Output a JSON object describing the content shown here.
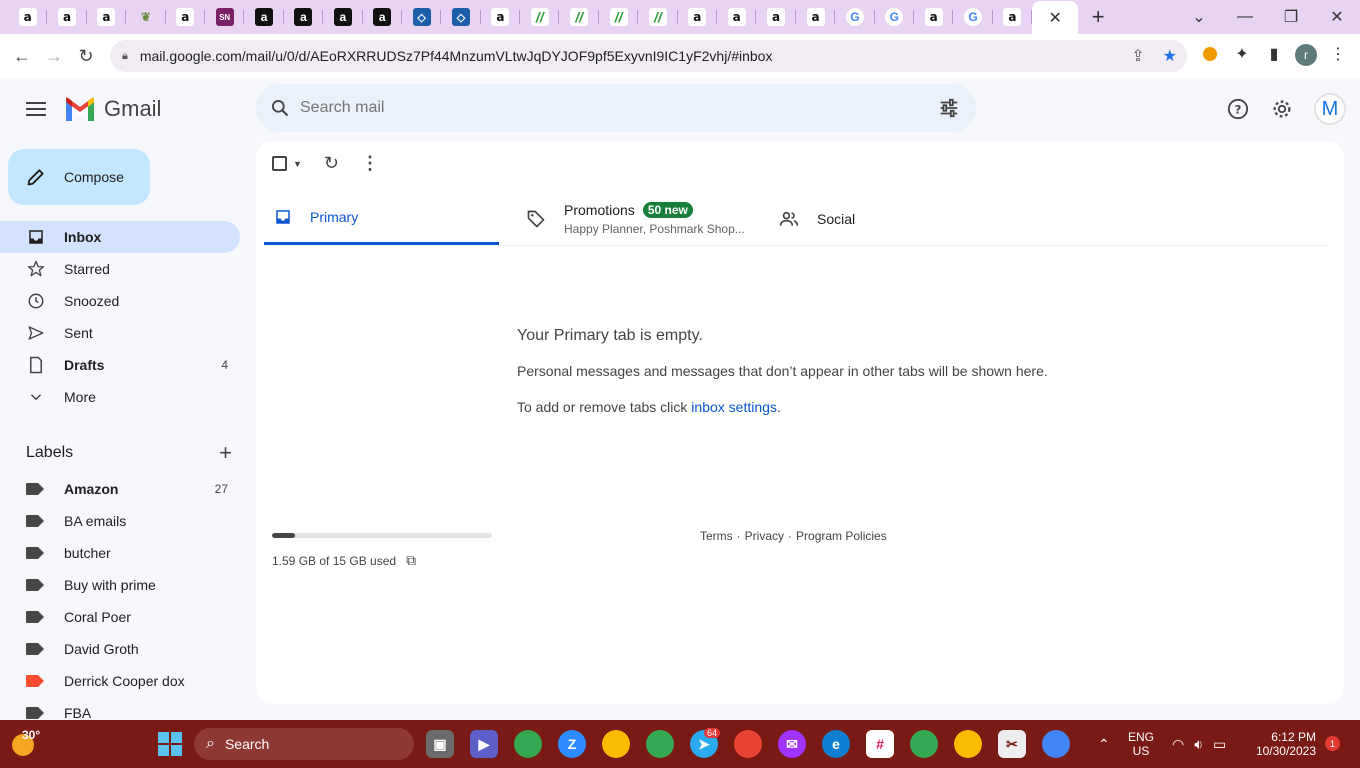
{
  "browser": {
    "tabs": [
      {
        "icon": "amazon-icon",
        "glyph": "a",
        "style": "amz"
      },
      {
        "icon": "amazon-icon",
        "glyph": "a",
        "style": "amz"
      },
      {
        "icon": "amazon-icon",
        "glyph": "a",
        "style": "amz"
      },
      {
        "icon": "plant-icon",
        "glyph": "❦",
        "style": "plant"
      },
      {
        "icon": "amazon-icon",
        "glyph": "a",
        "style": "amz"
      },
      {
        "icon": "sn-icon",
        "glyph": "SN",
        "style": "sn"
      },
      {
        "icon": "amazon-seller-icon",
        "glyph": "a",
        "style": "amzdark"
      },
      {
        "icon": "amazon-seller-icon",
        "glyph": "a",
        "style": "amzdark"
      },
      {
        "icon": "amazon-seller-icon",
        "glyph": "a",
        "style": "amzdark"
      },
      {
        "icon": "amazon-seller-icon",
        "glyph": "a",
        "style": "amzdark"
      },
      {
        "icon": "diamond-icon",
        "glyph": "◇",
        "style": "diamond"
      },
      {
        "icon": "diamond-icon",
        "glyph": "◇",
        "style": "diamond"
      },
      {
        "icon": "amazon-icon",
        "glyph": "a",
        "style": "amz"
      },
      {
        "icon": "green-swoosh-icon",
        "glyph": "//",
        "style": "green"
      },
      {
        "icon": "green-swoosh-icon",
        "glyph": "//",
        "style": "green"
      },
      {
        "icon": "green-swoosh-icon",
        "glyph": "//",
        "style": "green"
      },
      {
        "icon": "green-swoosh-icon",
        "glyph": "//",
        "style": "green"
      },
      {
        "icon": "amazon-icon",
        "glyph": "a",
        "style": "amz"
      },
      {
        "icon": "amazon-icon",
        "glyph": "a",
        "style": "amz"
      },
      {
        "icon": "amazon-icon",
        "glyph": "a",
        "style": "amz"
      },
      {
        "icon": "amazon-icon",
        "glyph": "a",
        "style": "amz"
      },
      {
        "icon": "google-icon",
        "glyph": "G",
        "style": "goog"
      },
      {
        "icon": "google-icon",
        "glyph": "G",
        "style": "goog"
      },
      {
        "icon": "amazon-icon",
        "glyph": "a",
        "style": "amz"
      },
      {
        "icon": "google-icon",
        "glyph": "G",
        "style": "goog"
      },
      {
        "icon": "amazon-icon",
        "glyph": "a",
        "style": "amz"
      }
    ],
    "url": "mail.google.com/mail/u/0/d/AEoRXRRUDSz7Pf44MnzumVLtwJqDYJOF9pf5ExyvnI9IC1yF2vhj/#inbox",
    "profile_initial": "r"
  },
  "gmail": {
    "app_name": "Gmail",
    "search_placeholder": "Search mail",
    "avatar_initial": "M",
    "compose_label": "Compose",
    "nav": [
      {
        "name": "inbox",
        "label": "Inbox",
        "count": "",
        "active": true,
        "bold": true
      },
      {
        "name": "starred",
        "label": "Starred",
        "count": "",
        "active": false,
        "bold": false
      },
      {
        "name": "snoozed",
        "label": "Snoozed",
        "count": "",
        "active": false,
        "bold": false
      },
      {
        "name": "sent",
        "label": "Sent",
        "count": "",
        "active": false,
        "bold": false
      },
      {
        "name": "drafts",
        "label": "Drafts",
        "count": "4",
        "active": false,
        "bold": true
      },
      {
        "name": "more",
        "label": "More",
        "count": "",
        "active": false,
        "bold": false
      }
    ],
    "labels_title": "Labels",
    "labels": [
      {
        "label": "Amazon",
        "count": "27",
        "bold": true,
        "color": "#444746"
      },
      {
        "label": "BA emails",
        "count": "",
        "bold": false,
        "color": "#444746"
      },
      {
        "label": "butcher",
        "count": "",
        "bold": false,
        "color": "#444746"
      },
      {
        "label": "Buy with prime",
        "count": "",
        "bold": false,
        "color": "#444746"
      },
      {
        "label": "Coral Poer",
        "count": "",
        "bold": false,
        "color": "#444746"
      },
      {
        "label": "David Groth",
        "count": "",
        "bold": false,
        "color": "#444746"
      },
      {
        "label": "Derrick Cooper dox",
        "count": "",
        "bold": false,
        "color": "#fb4c2f"
      },
      {
        "label": "FBA",
        "count": "",
        "bold": false,
        "color": "#444746"
      }
    ],
    "tabs": {
      "primary": "Primary",
      "promotions": "Promotions",
      "promotions_badge": "50 new",
      "promotions_sub": "Happy Planner, Poshmark Shop...",
      "social": "Social"
    },
    "empty": {
      "heading": "Your Primary tab is empty.",
      "line1": "Personal messages and messages that don’t appear in other tabs will be shown here.",
      "line2_prefix": "To add or remove tabs click ",
      "line2_link": "inbox settings",
      "line2_suffix": "."
    },
    "storage": {
      "text": "1.59 GB of 15 GB used",
      "used_fraction": 0.106
    },
    "footer": {
      "terms": "Terms",
      "sep1": "·",
      "privacy": "Privacy",
      "sep2": "·",
      "policies": "Program Policies"
    }
  },
  "taskbar": {
    "temperature": "30°",
    "search_label": "Search",
    "lang": "ENG",
    "region": "US",
    "time": "6:12 PM",
    "date": "10/30/2023",
    "notification_count": "1",
    "telegram_badge": "64"
  },
  "colors": {
    "accent": "#0b57d0",
    "compose_bg": "#c2e7ff",
    "active_nav": "#d3e3fd",
    "badge_green": "#188038",
    "taskbar": "#7a1a14",
    "tabstrip": "#e8d3f3"
  }
}
